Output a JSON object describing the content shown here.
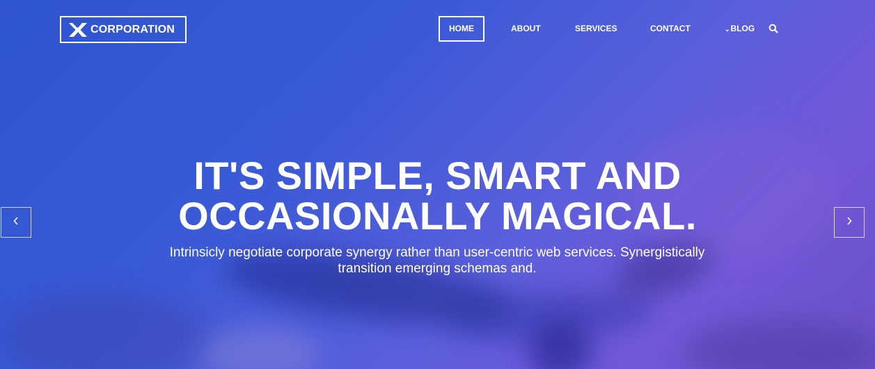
{
  "brand": {
    "logo_icon": "x-mark-icon",
    "name": "CORPORATION"
  },
  "nav": {
    "items": [
      {
        "label": "HOME",
        "active": true
      },
      {
        "label": "ABOUT",
        "active": false
      },
      {
        "label": "SERVICES",
        "active": false
      },
      {
        "label": "CONTACT",
        "active": false
      },
      {
        "label": "BLOG",
        "active": false,
        "icon": "chevron-down-icon"
      }
    ],
    "search_icon": "search-icon"
  },
  "hero": {
    "headline_line1": "IT'S SIMPLE, SMART AND",
    "headline_line2": "OCCASIONALLY MAGICAL.",
    "subtext": "Intrinsicly negotiate corporate synergy rather than user-centric web services. Synergistically transition emerging schemas and.",
    "prev_icon": "chevron-left-icon",
    "next_icon": "chevron-right-icon"
  },
  "colors": {
    "overlay_start": "#2f55cf",
    "overlay_end": "#7358d8",
    "text": "#ffffff"
  }
}
